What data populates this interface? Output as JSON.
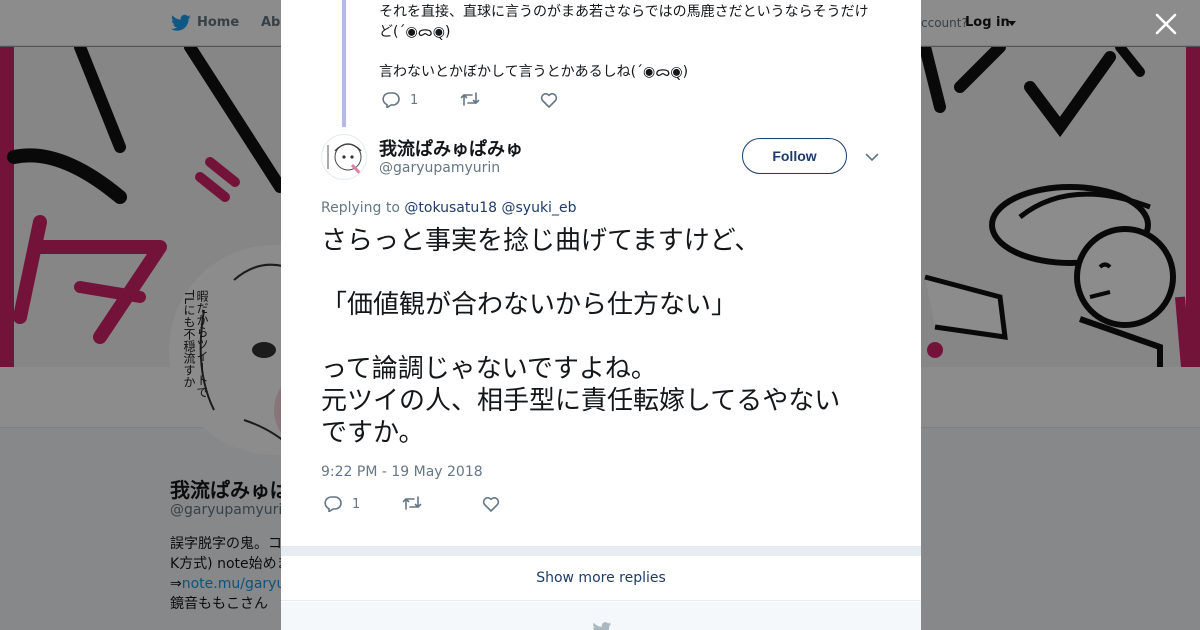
{
  "nav": {
    "home_label": "Home",
    "about_label": "Abo",
    "account_label": "ccount?",
    "login_label": "Log in"
  },
  "background_profile": {
    "name": "我流ぱみゅぱみゅ",
    "handle": "@garyupamyurin",
    "bio_line1": "誤字脱字の鬼。コ",
    "bio_line2": "K方式) note始めま",
    "bio_line3_prefix": "⇒",
    "bio_line3_link": "note.mu/garyup",
    "bio_line4": "鏡音ももこさん",
    "avatar_caption": "暇だからツイートでTLにも不穏流すか"
  },
  "parent_tweet": {
    "text": "それを直接、直球に言うのがまあ若さならではの馬鹿さだというならそうだけど(´◉ᯅ◉͏̖̖̖)\n\n言わないとかぼかして言うとかあるしね(´◉ᯅ◉͏̖̖̖)",
    "reply_count": "1"
  },
  "tweet": {
    "name": "我流ぱみゅぱみゅ",
    "handle": "@garyupamyurin",
    "follow_label": "Follow",
    "replying_prefix": "Replying to",
    "reply_to_1": "@tokusatu18",
    "reply_to_2": "@syuki_eb",
    "text": "さらっと事実を捻じ曲げてますけど、\n\n「価値観が合わないから仕方ない」\n\nって論調じゃないですよね。\n元ツイの人、相手型に責任転嫁してるやない\nですか。",
    "timestamp": "9:22 PM - 19 May 2018",
    "reply_count": "1"
  },
  "show_more_label": "Show more replies",
  "colors": {
    "twitter_blue": "#1da1f2",
    "link_navy": "#1d3c6a",
    "banner_pink": "#d3236b",
    "thread_line": "#b4b9ea"
  },
  "icons": [
    "twitter-bird-icon",
    "close-icon",
    "reply-icon",
    "retweet-icon",
    "like-icon",
    "chevron-down-icon",
    "caret-down-icon"
  ]
}
